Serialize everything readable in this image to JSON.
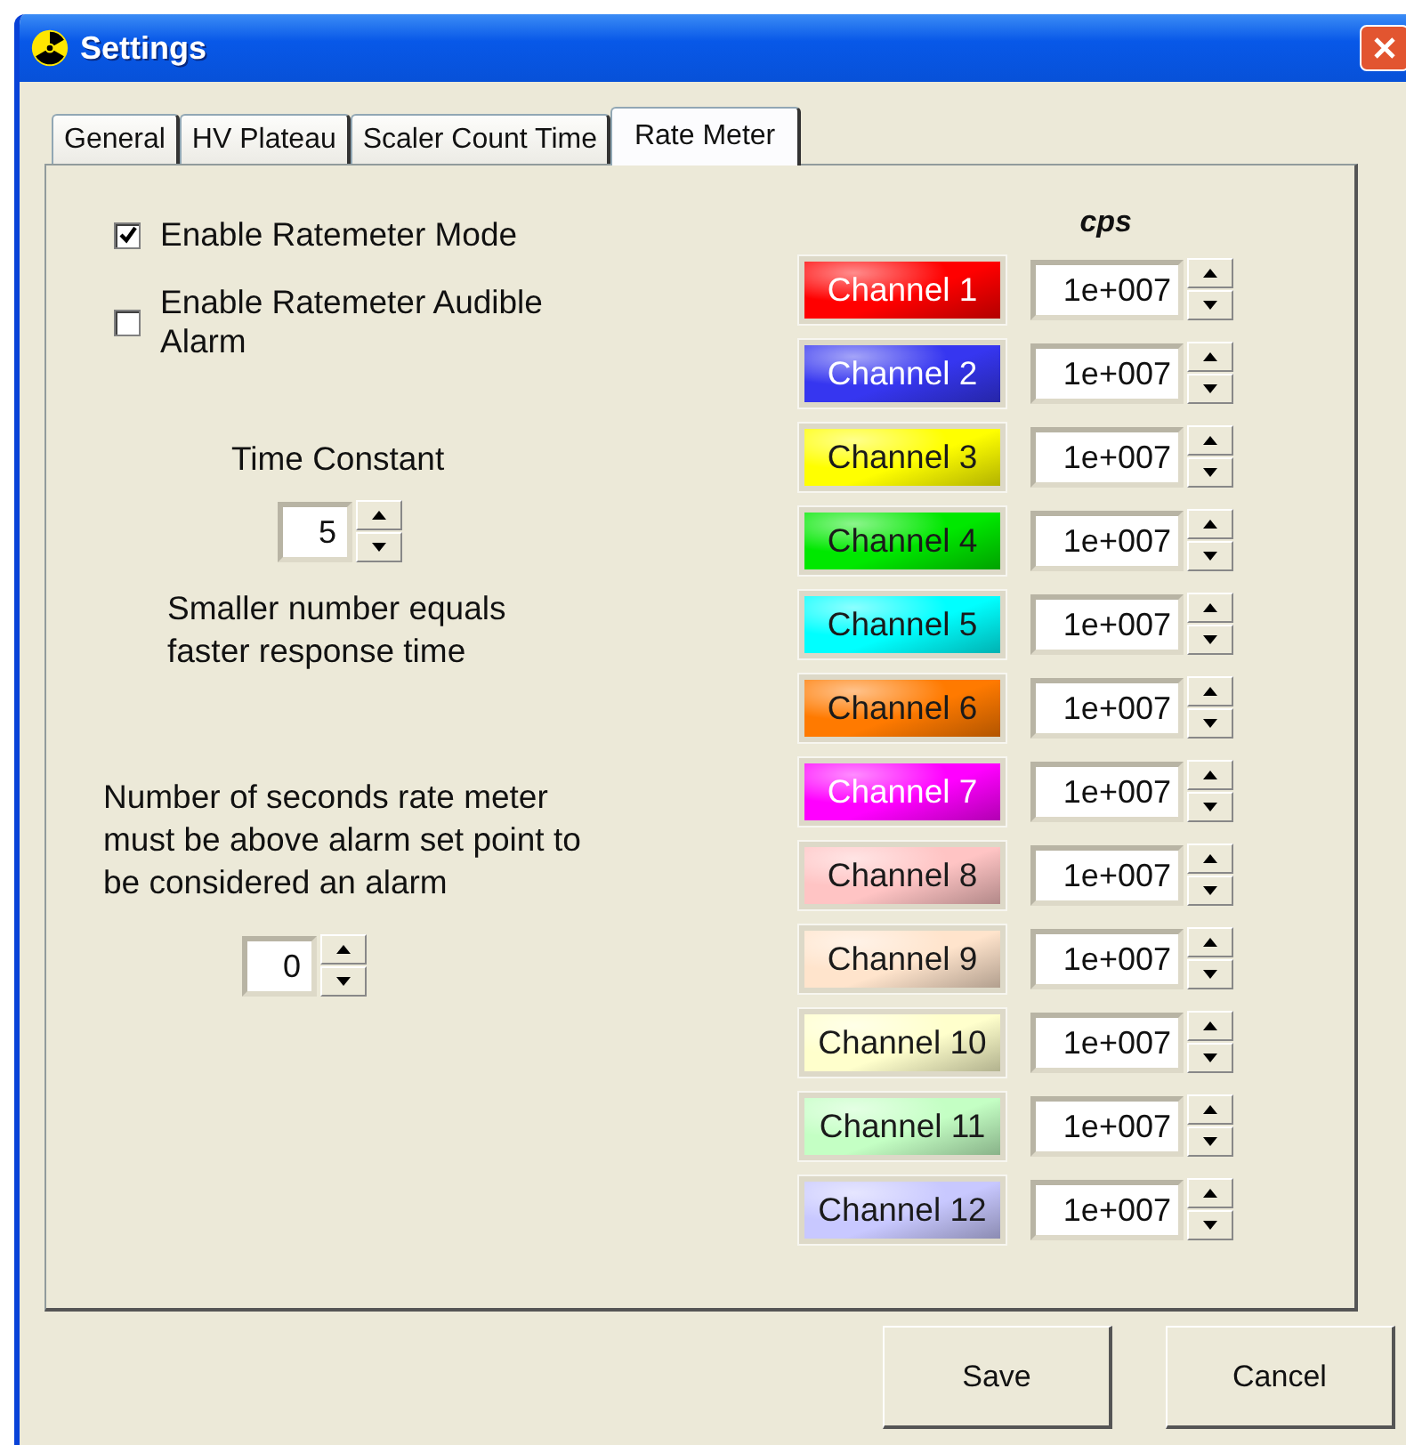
{
  "window": {
    "title": "Settings"
  },
  "tabs": [
    {
      "label": "General",
      "selected": false
    },
    {
      "label": "HV Plateau",
      "selected": false
    },
    {
      "label": "Scaler Count Time",
      "selected": false
    },
    {
      "label": "Rate Meter",
      "selected": true
    }
  ],
  "options": [
    {
      "label": "Enable Ratemeter Mode",
      "checked": true
    },
    {
      "label": "Enable Ratemeter Audible Alarm",
      "checked": false
    }
  ],
  "time_constant": {
    "label": "Time Constant",
    "value": "5",
    "note": "Smaller number equals faster response time"
  },
  "alarm_delay": {
    "label": "Number of seconds rate meter must be above alarm set point to be considered an alarm",
    "value": "0"
  },
  "cps_header": "cps",
  "channels": [
    {
      "name": "Channel 1",
      "color": "#ff0000",
      "value": "1e+007"
    },
    {
      "name": "Channel 2",
      "color": "#3636f0",
      "value": "1e+007"
    },
    {
      "name": "Channel 3",
      "color": "#ffff00",
      "value": "1e+007"
    },
    {
      "name": "Channel 4",
      "color": "#00e800",
      "value": "1e+007"
    },
    {
      "name": "Channel 5",
      "color": "#00ffff",
      "value": "1e+007"
    },
    {
      "name": "Channel 6",
      "color": "#ff7a00",
      "value": "1e+007"
    },
    {
      "name": "Channel 7",
      "color": "#ff00ff",
      "value": "1e+007"
    },
    {
      "name": "Channel 8",
      "color": "#ffc4c4",
      "value": "1e+007"
    },
    {
      "name": "Channel 9",
      "color": "#ffe4cc",
      "value": "1e+007"
    },
    {
      "name": "Channel 10",
      "color": "#ffffcc",
      "value": "1e+007"
    },
    {
      "name": "Channel 11",
      "color": "#c4ffc4",
      "value": "1e+007"
    },
    {
      "name": "Channel 12",
      "color": "#c8c8ff",
      "value": "1e+007"
    }
  ],
  "buttons": [
    "Save",
    "Cancel"
  ]
}
